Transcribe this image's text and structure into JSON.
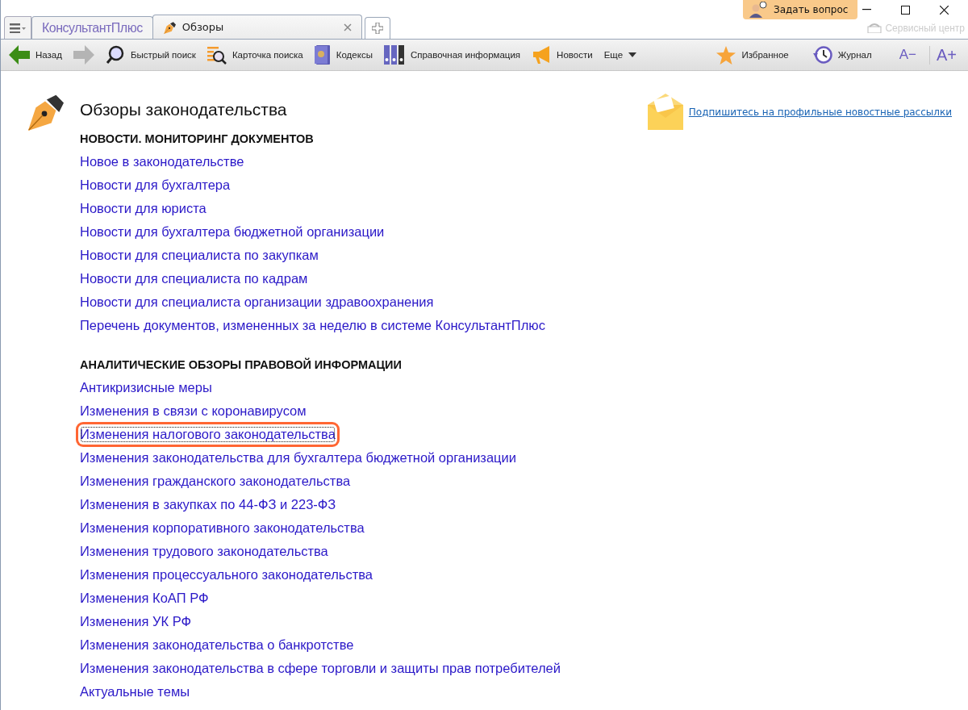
{
  "tabs": [
    {
      "label": "КонсультантПлюс",
      "kind": "logo",
      "selected": false
    },
    {
      "label": "Обзоры",
      "kind": "page",
      "selected": true
    }
  ],
  "ask_button": "Задать вопрос",
  "service_center": "Сервисный центр",
  "toolbar": [
    {
      "label": "Назад",
      "kind": "back"
    },
    {
      "kind": "forward"
    },
    {
      "label": "Быстрый поиск",
      "kind": "search"
    },
    {
      "label": "Карточка поиска",
      "kind": "card"
    },
    {
      "label": "Кодексы",
      "kind": "codes"
    },
    {
      "label": "Справочная информация",
      "kind": "binders"
    },
    {
      "label": "Новости",
      "kind": "news"
    },
    {
      "label": "Еще",
      "kind": "more"
    }
  ],
  "toolbar_right": [
    {
      "label": "Избранное",
      "kind": "star"
    },
    {
      "label": "Журнал",
      "kind": "history"
    }
  ],
  "font_buttons": [
    "A−",
    "A+"
  ],
  "page_title": "Обзоры законодательства",
  "subscribe_link": "Подпишитесь на профильные новостные рассылки",
  "sections": [
    {
      "heading": "НОВОСТИ. МОНИТОРИНГ ДОКУМЕНТОВ",
      "links": [
        {
          "text": "Новое в законодательстве",
          "selected": false
        },
        {
          "text": "Новости для бухгалтера",
          "selected": false
        },
        {
          "text": "Новости для юриста",
          "selected": false
        },
        {
          "text": "Новости для бухгалтера бюджетной организации",
          "selected": false
        },
        {
          "text": "Новости для специалиста по закупкам",
          "selected": false
        },
        {
          "text": "Новости для специалиста по кадрам",
          "selected": false
        },
        {
          "text": "Новости для специалиста организации здравоохранения",
          "selected": false
        },
        {
          "text": "Перечень документов, измененных за неделю в системе КонсультантПлюс",
          "selected": false
        }
      ]
    },
    {
      "heading": "АНАЛИТИЧЕСКИЕ ОБЗОРЫ ПРАВОВОЙ ИНФОРМАЦИИ",
      "links": [
        {
          "text": "Антикризисные меры",
          "selected": false
        },
        {
          "text": "Изменения в связи с коронавирусом",
          "selected": false
        },
        {
          "text": "Изменения налогового законодательства",
          "selected": true
        },
        {
          "text": "Изменения законодательства для бухгалтера бюджетной организации",
          "selected": false
        },
        {
          "text": "Изменения гражданского законодательства",
          "selected": false
        },
        {
          "text": "Изменения в закупках по 44-ФЗ и 223-ФЗ",
          "selected": false
        },
        {
          "text": "Изменения корпоративного законодательства",
          "selected": false
        },
        {
          "text": "Изменения трудового законодательства",
          "selected": false
        },
        {
          "text": "Изменения процессуального законодательства",
          "selected": false
        },
        {
          "text": "Изменения КоАП РФ",
          "selected": false
        },
        {
          "text": "Изменения УК РФ",
          "selected": false
        },
        {
          "text": "Изменения законодательства о банкротстве",
          "selected": false
        },
        {
          "text": "Изменения законодательства в сфере торговли и защиты прав потребителей",
          "selected": false
        },
        {
          "text": "Актуальные темы",
          "selected": false
        }
      ]
    }
  ]
}
